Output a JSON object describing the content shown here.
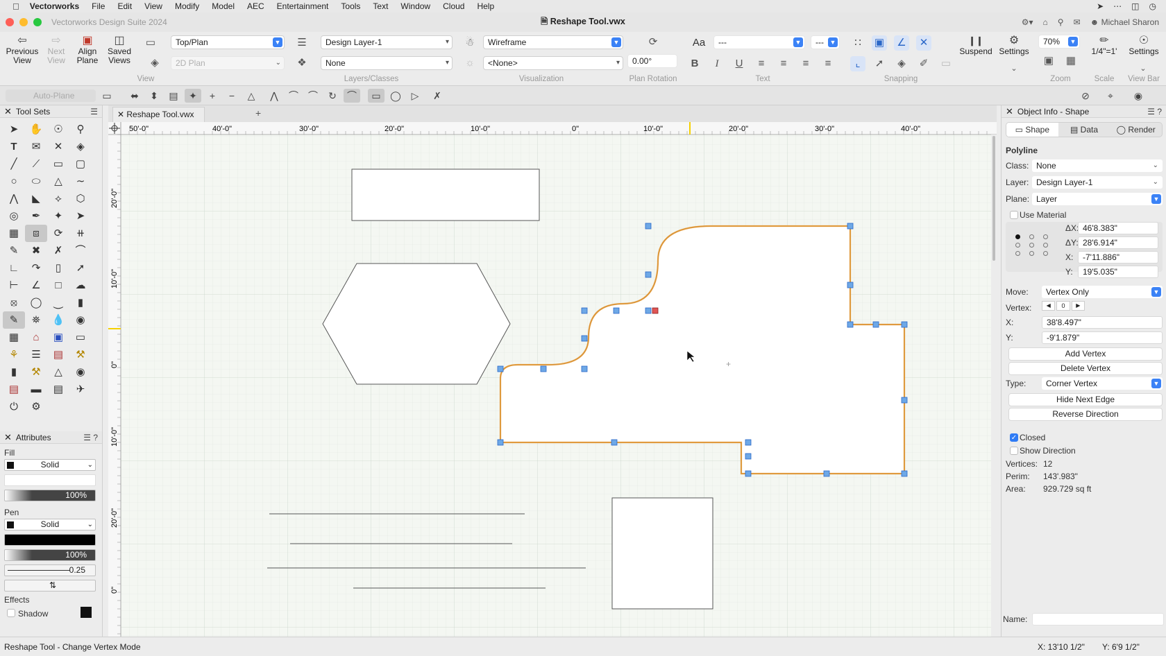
{
  "menubar": {
    "app": "Vectorworks",
    "items": [
      "File",
      "Edit",
      "View",
      "Modify",
      "Model",
      "AEC",
      "Entertainment",
      "Tools",
      "Text",
      "Window",
      "Cloud",
      "Help"
    ]
  },
  "window": {
    "suite": "Vectorworks Design Suite 2024",
    "doc_title": "Reshape Tool.vwx",
    "user": "Michael Sharon"
  },
  "toolbar": {
    "previous_view": "Previous View",
    "next_view": "Next View",
    "align_plane": "Align Plane",
    "saved_views": "Saved Views",
    "view_group": "View",
    "view_select": "Top/Plan",
    "render_select": "2D Plan",
    "layer_select": "Design Layer-1",
    "class_select": "None",
    "layers_group": "Layers/Classes",
    "render_mode": "Wireframe",
    "light_select": "<None>",
    "vis_group": "Visualization",
    "plan_rotation_value": "0.00°",
    "plan_rotation_group": "Plan Rotation",
    "font_icon": "Aa",
    "font_value": "---",
    "size_value": "---",
    "text_group": "Text",
    "bold": "B",
    "italic": "I",
    "underline": "U",
    "snapping_group": "Snapping",
    "suspend": "Suspend",
    "snap_settings": "Settings",
    "zoom_value": "70%",
    "zoom_group": "Zoom",
    "scale_value": "1/4\"=1'",
    "scale_group": "Scale",
    "viewbar_settings": "Settings",
    "viewbar_group": "View Bar"
  },
  "modebar": {
    "auto_plane": "Auto-Plane"
  },
  "toolsets": {
    "title": "Tool Sets"
  },
  "attributes": {
    "title": "Attributes",
    "fill_label": "Fill",
    "fill_style": "Solid",
    "fill_opacity": "100%",
    "pen_label": "Pen",
    "pen_style": "Solid",
    "pen_opacity": "100%",
    "line_weight": "0.25",
    "effects_label": "Effects",
    "shadow_label": "Shadow"
  },
  "doc_tab": "Reshape Tool.vwx",
  "rulers": {
    "top": [
      "50'-0\"",
      "40'-0\"",
      "30'-0\"",
      "20'-0\"",
      "10'-0\"",
      "0\"",
      "10'-0\"",
      "20'-0\"",
      "30'-0\"",
      "40'-0\""
    ],
    "left": [
      "20'-0\"",
      "10'-0\"",
      "0\"",
      "10'-0\"",
      "20'-0\"",
      "0\""
    ]
  },
  "oip": {
    "title": "Object Info - Shape",
    "tab_shape": "Shape",
    "tab_data": "Data",
    "tab_render": "Render",
    "object_type": "Polyline",
    "class_label": "Class:",
    "class_value": "None",
    "layer_label": "Layer:",
    "layer_value": "Design Layer-1",
    "plane_label": "Plane:",
    "plane_value": "Layer",
    "use_material": "Use Material",
    "dx_label": "ΔX:",
    "dx_value": "46'8.383\"",
    "dy_label": "ΔY:",
    "dy_value": "28'6.914\"",
    "x_label": "X:",
    "x_value": "-7'11.886\"",
    "y_label": "Y:",
    "y_value": "19'5.035\"",
    "move_label": "Move:",
    "move_value": "Vertex Only",
    "vertex_label": "Vertex:",
    "vertex_index": "0",
    "vx_label": "X:",
    "vx_value": "38'8.497\"",
    "vy_label": "Y:",
    "vy_value": "-9'1.879\"",
    "add_vertex": "Add Vertex",
    "delete_vertex": "Delete Vertex",
    "type_label": "Type:",
    "type_value": "Corner Vertex",
    "hide_next_edge": "Hide Next Edge",
    "reverse_direction": "Reverse Direction",
    "closed_label": "Closed",
    "show_direction_label": "Show Direction",
    "vertices_label": "Vertices:",
    "vertices_value": "12",
    "perim_label": "Perim:",
    "perim_value": "143'.983\"",
    "area_label": "Area:",
    "area_value": "929.729 sq ft",
    "name_label": "Name:"
  },
  "status": {
    "tool": "Reshape Tool  -  Change Vertex Mode",
    "x_coord": "X: 13'10 1/2\"",
    "y_coord": "Y: 6'9 1/2\""
  },
  "colors": {
    "accent": "#3b82f6",
    "selection": "#e8a040",
    "handle": "#6ea8e6"
  }
}
